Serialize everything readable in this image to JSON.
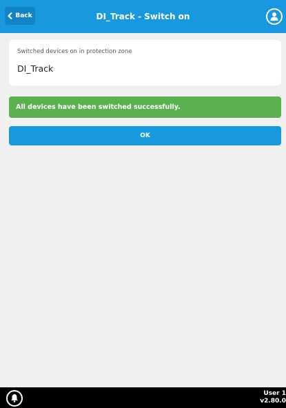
{
  "header": {
    "back_label": "Back",
    "title": "DI_Track - Switch on",
    "back_icon": "chevron-left-icon",
    "user_icon": "user-icon"
  },
  "info": {
    "label": "Switched devices on in protection zone",
    "value": "DI_Track"
  },
  "message": {
    "text": "All devices have been switched successfully."
  },
  "actions": {
    "ok_label": "OK"
  },
  "footer": {
    "user": "User 1",
    "version": "v2.80.0",
    "bell_icon": "bell-icon"
  },
  "colors": {
    "primary": "#1898de",
    "success": "#5bb050",
    "background": "#f0f0f0",
    "footer": "#000000"
  }
}
